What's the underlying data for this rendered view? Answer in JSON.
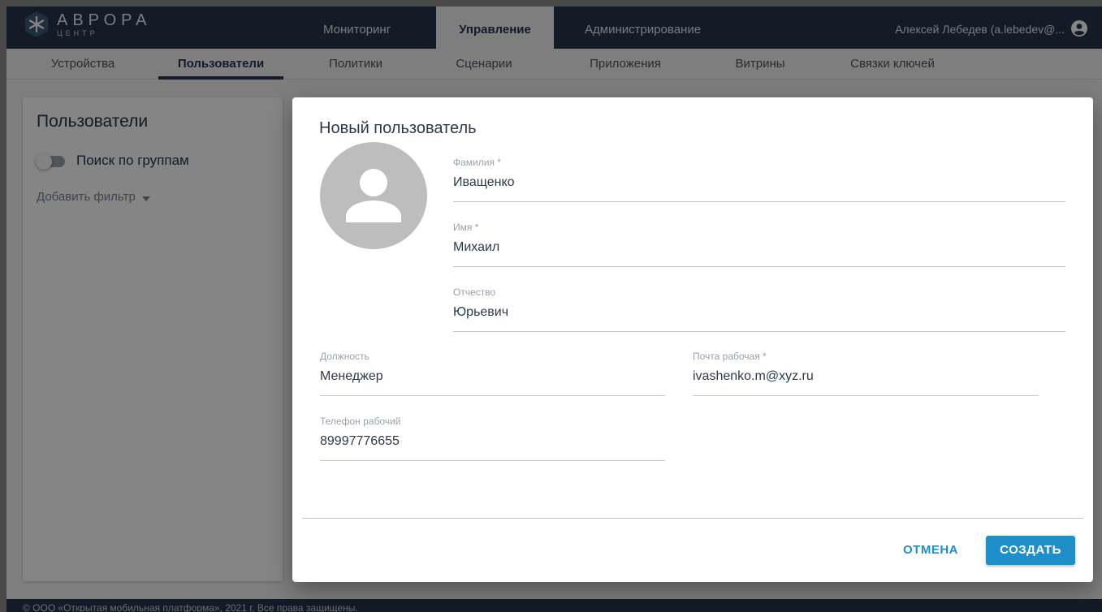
{
  "brand": {
    "title": "АВРОРА",
    "subtitle": "ЦЕНТР"
  },
  "main_nav": {
    "tabs": [
      {
        "label": "Мониторинг"
      },
      {
        "label": "Управление"
      },
      {
        "label": "Администрирование"
      }
    ],
    "active_tab": "Управление"
  },
  "user": {
    "name": "Алексей Лебедев (a.lebedev@..."
  },
  "sub_nav": {
    "tabs": [
      {
        "label": "Устройства"
      },
      {
        "label": "Пользователи"
      },
      {
        "label": "Политики"
      },
      {
        "label": "Сценарии"
      },
      {
        "label": "Приложения"
      },
      {
        "label": "Витрины"
      },
      {
        "label": "Связки ключей"
      }
    ],
    "active_tab": "Пользователи"
  },
  "left_panel": {
    "title": "Пользователи",
    "toggle_label": "Поиск по группам",
    "toggle_on": false,
    "add_filter": "Добавить фильтр"
  },
  "dialog": {
    "title": "Новый пользователь",
    "fields": {
      "last_name": {
        "label": "Фамилия *",
        "value": "Иващенко"
      },
      "first_name": {
        "label": "Имя *",
        "value": "Михаил"
      },
      "middle_name": {
        "label": "Отчество",
        "value": "Юрьевич"
      },
      "position": {
        "label": "Должность",
        "value": "Менеджер"
      },
      "work_email": {
        "label": "Почта рабочая *",
        "value": "ivashenko.m@xyz.ru"
      },
      "work_phone": {
        "label": "Телефон рабочий",
        "value": "89997776655"
      }
    },
    "cancel_label": "ОТМЕНА",
    "create_label": "СОЗДАТЬ"
  },
  "footer": {
    "text": "© ООО «Открытая мобильная платформа», 2021 г. Все права защищены."
  },
  "colors": {
    "header": "#26364a",
    "accent": "#1f8fc9",
    "avatar": "#bdbdbd"
  }
}
